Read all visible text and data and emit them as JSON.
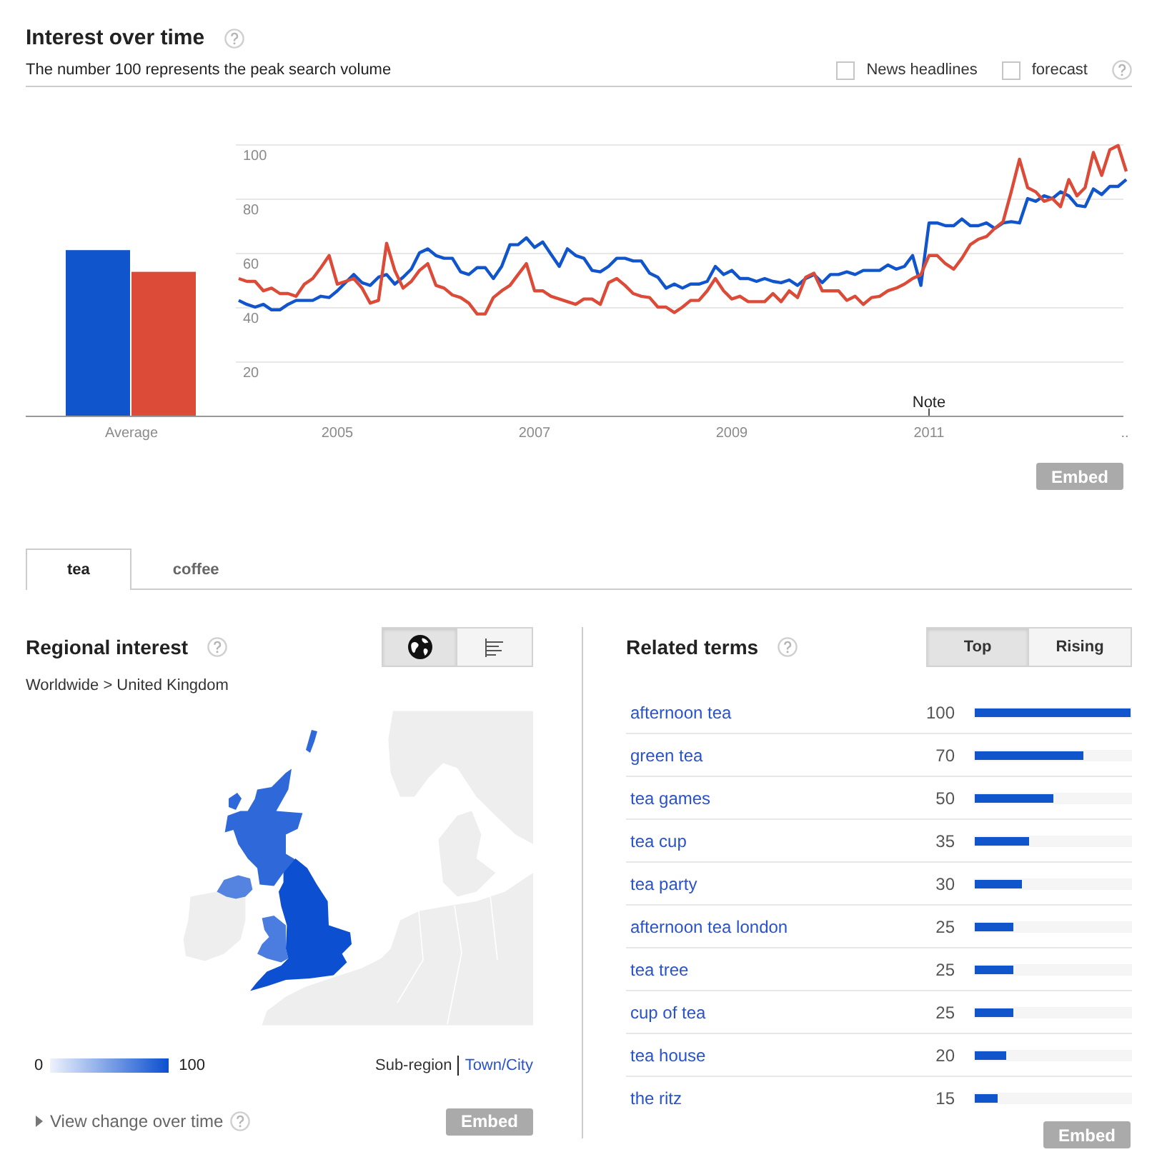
{
  "interest_over_time": {
    "title": "Interest over time",
    "subtitle": "The number 100 represents the peak search volume",
    "options": [
      {
        "label": "News headlines",
        "checked": false
      },
      {
        "label": "forecast",
        "checked": false
      }
    ],
    "average": {
      "chart_data": {
        "type": "bar",
        "categories": [
          "Average"
        ],
        "series": [
          {
            "color": "#1155cc",
            "values": [
              61
            ]
          },
          {
            "color": "#dc4a38",
            "values": [
              53
            ]
          }
        ],
        "ylim": [
          0,
          100
        ]
      }
    },
    "trend": {
      "chart_data": {
        "type": "line",
        "x": [
          2004,
          2004.083,
          2004.167,
          2004.25,
          2004.333,
          2004.417,
          2004.5,
          2004.583,
          2004.667,
          2004.75,
          2004.833,
          2004.917,
          2005,
          2005.083,
          2005.167,
          2005.25,
          2005.333,
          2005.417,
          2005.5,
          2005.583,
          2005.667,
          2005.75,
          2005.833,
          2005.917,
          2006,
          2006.083,
          2006.167,
          2006.25,
          2006.333,
          2006.417,
          2006.5,
          2006.583,
          2006.667,
          2006.75,
          2006.833,
          2006.917,
          2007,
          2007.083,
          2007.167,
          2007.25,
          2007.333,
          2007.417,
          2007.5,
          2007.583,
          2007.667,
          2007.75,
          2007.833,
          2007.917,
          2008,
          2008.083,
          2008.167,
          2008.25,
          2008.333,
          2008.417,
          2008.5,
          2008.583,
          2008.667,
          2008.75,
          2008.833,
          2008.917,
          2009,
          2009.083,
          2009.167,
          2009.25,
          2009.333,
          2009.417,
          2009.5,
          2009.583,
          2009.667,
          2009.75,
          2009.833,
          2009.917,
          2010,
          2010.083,
          2010.167,
          2010.25,
          2010.333,
          2010.417,
          2010.5,
          2010.583,
          2010.667,
          2010.75,
          2010.833,
          2010.917,
          2011,
          2011.083,
          2011.167,
          2011.25,
          2011.333,
          2011.417,
          2011.5,
          2011.583,
          2011.667,
          2011.75,
          2011.833,
          2011.917,
          2012,
          2012.083,
          2012.167,
          2012.25,
          2012.333,
          2012.417,
          2012.5,
          2012.583,
          2012.667,
          2012.75,
          2012.833,
          2012.917,
          2013
        ],
        "xlim": [
          2004,
          2013
        ],
        "ylim": [
          0,
          100
        ],
        "grid": true,
        "xticks": [
          2005,
          2007,
          2009,
          2011,
          {
            "value": 2013,
            "label": ".."
          }
        ],
        "yticks": [
          20,
          40,
          60,
          80,
          100
        ],
        "series": [
          {
            "color": "#1155cc",
            "values": [
              42.5,
              41,
              40,
              41,
              39,
              39,
              41,
              42.5,
              42.5,
              42.5,
              44,
              43.5,
              46,
              49,
              52,
              49,
              48,
              51,
              52,
              48.5,
              51,
              54,
              60,
              61.5,
              59,
              58,
              58,
              53,
              52,
              54.5,
              54.5,
              50.5,
              55,
              63,
              63,
              65.5,
              62,
              64,
              59.5,
              55,
              61.5,
              59,
              58,
              53.5,
              53,
              55,
              58,
              58,
              57,
              57,
              52.5,
              51,
              47,
              48.5,
              47,
              48.5,
              48.5,
              49.5,
              55,
              52,
              53.5,
              50.5,
              50.5,
              49.5,
              50.5,
              49.5,
              49,
              50,
              48,
              50.5,
              52,
              49,
              52,
              52,
              53,
              52,
              53.5,
              53.5,
              53.5,
              55.5,
              54,
              55,
              59,
              48,
              71,
              71,
              70,
              70,
              72.5,
              70,
              70,
              71,
              69,
              71,
              71.5,
              71,
              80,
              79,
              81,
              80,
              82.5,
              81,
              77.5,
              77,
              83.5,
              81.5,
              84.5,
              84.5,
              87
            ]
          },
          {
            "color": "#dc4a38",
            "values": [
              50.5,
              49.5,
              49.5,
              46,
              47,
              45,
              45,
              44,
              48.5,
              50.5,
              54.5,
              59,
              48.5,
              49.5,
              50.5,
              47,
              41.5,
              42.5,
              63.5,
              53.5,
              47,
              49.5,
              53.5,
              56,
              48,
              47,
              44.5,
              43.5,
              41.5,
              37.5,
              37.5,
              43.5,
              46,
              48,
              52,
              56,
              46,
              46,
              44,
              43,
              42,
              41,
              43,
              43,
              41,
              49,
              50.5,
              48,
              45,
              44,
              43.5,
              40,
              40,
              38,
              40,
              42.5,
              42.5,
              46,
              50.5,
              46,
              43,
              44,
              42,
              42,
              42,
              45,
              42,
              46,
              43.5,
              51,
              52.5,
              46,
              46,
              46,
              42.5,
              44,
              41,
              43.5,
              44,
              46,
              47,
              48.5,
              50.5,
              52,
              59,
              59,
              56,
              54,
              58,
              63,
              65,
              66,
              69,
              71.5,
              82.5,
              94.5,
              84,
              82.5,
              79,
              80,
              77,
              87,
              81,
              84,
              97,
              88.5,
              98,
              99.5,
              90
            ]
          }
        ],
        "annotations": [
          "Note"
        ]
      }
    },
    "embed_button": "Embed"
  },
  "tabs": [
    {
      "label": "tea",
      "selected": true
    },
    {
      "label": "coffee",
      "selected": false
    }
  ],
  "regional_interest": {
    "title": "Regional interest",
    "views": [
      {
        "kind": "map",
        "selected": true
      },
      {
        "kind": "list",
        "selected": false
      }
    ],
    "breadcrumb": "Worldwide > United Kingdom",
    "map": {
      "regions": [
        {
          "kind": "scotland",
          "color": "#2f69d9"
        },
        {
          "kind": "northernireland",
          "color": "#5483e0"
        },
        {
          "kind": "wales",
          "color": "#4a7ddf"
        },
        {
          "kind": "england",
          "color": "#0c4fd0"
        }
      ]
    },
    "legend": {
      "min": "0",
      "max": "100"
    },
    "levels": [
      {
        "label": "Sub-region",
        "selected": true
      },
      {
        "label": "Town/City",
        "selected": false
      }
    ],
    "view_change": "View change over time",
    "embed_button": "Embed"
  },
  "related_terms": {
    "title": "Related terms",
    "modes": [
      {
        "label": "Top",
        "selected": true
      },
      {
        "label": "Rising",
        "selected": false
      }
    ],
    "rows": [
      {
        "term": "afternoon tea",
        "value": "100",
        "level": 1
      },
      {
        "term": "green tea",
        "value": "70",
        "level": 0.7
      },
      {
        "term": "tea games",
        "value": "50",
        "level": 0.5
      },
      {
        "term": "tea cup",
        "value": "35",
        "level": 0.35
      },
      {
        "term": "tea party",
        "value": "30",
        "level": 0.3
      },
      {
        "term": "afternoon tea london",
        "value": "25",
        "level": 0.25
      },
      {
        "term": "tea tree",
        "value": "25",
        "level": 0.25
      },
      {
        "term": "cup of tea",
        "value": "25",
        "level": 0.25
      },
      {
        "term": "tea house",
        "value": "20",
        "level": 0.2
      },
      {
        "term": "the ritz",
        "value": "15",
        "level": 0.15
      }
    ],
    "embed_button": "Embed"
  }
}
